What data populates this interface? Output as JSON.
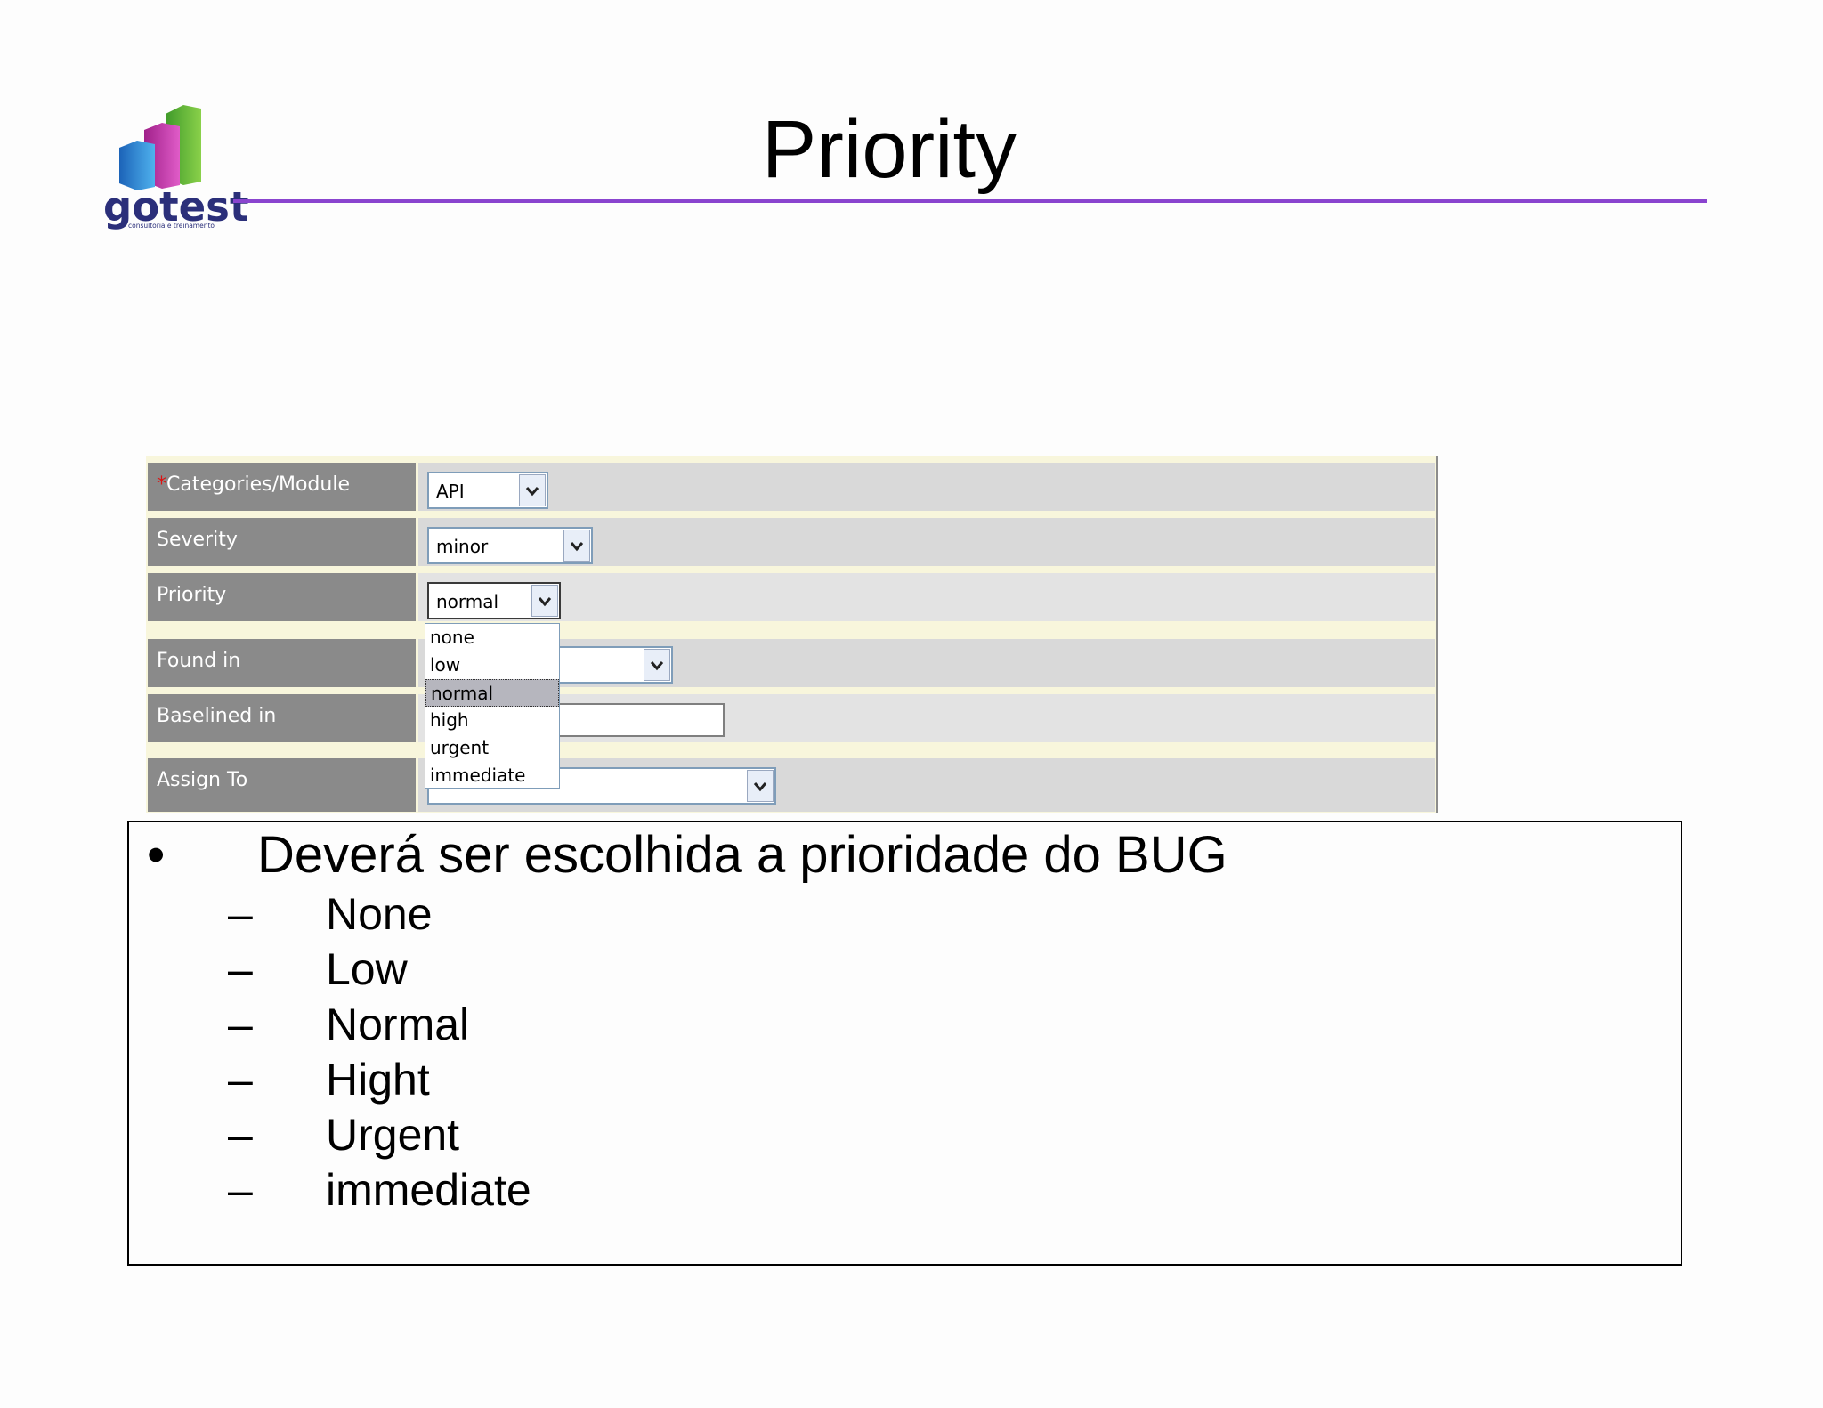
{
  "slide": {
    "title": "Priority",
    "accent_color": "#8a44cf"
  },
  "logo": {
    "brand": "gotest",
    "tagline": "consultoria e treinamento"
  },
  "form": {
    "rows": [
      {
        "label": "Categories/Module",
        "required_mark": "*",
        "value": "API"
      },
      {
        "label": "Severity",
        "value": "minor"
      },
      {
        "label": "Priority",
        "value": "normal"
      },
      {
        "label": "Found in",
        "value": ""
      },
      {
        "label": "Baselined in",
        "value": ""
      },
      {
        "label": "Assign To",
        "value": ""
      }
    ],
    "priority_options": [
      "none",
      "low",
      "normal",
      "high",
      "urgent",
      "immediate"
    ],
    "priority_selected": "normal"
  },
  "notes": {
    "heading": "Deverá ser escolhida a prioridade do BUG",
    "bullet": "•",
    "dash": "–",
    "items": [
      "None",
      "Low",
      "Normal",
      "Hight",
      "Urgent",
      "immediate"
    ]
  }
}
